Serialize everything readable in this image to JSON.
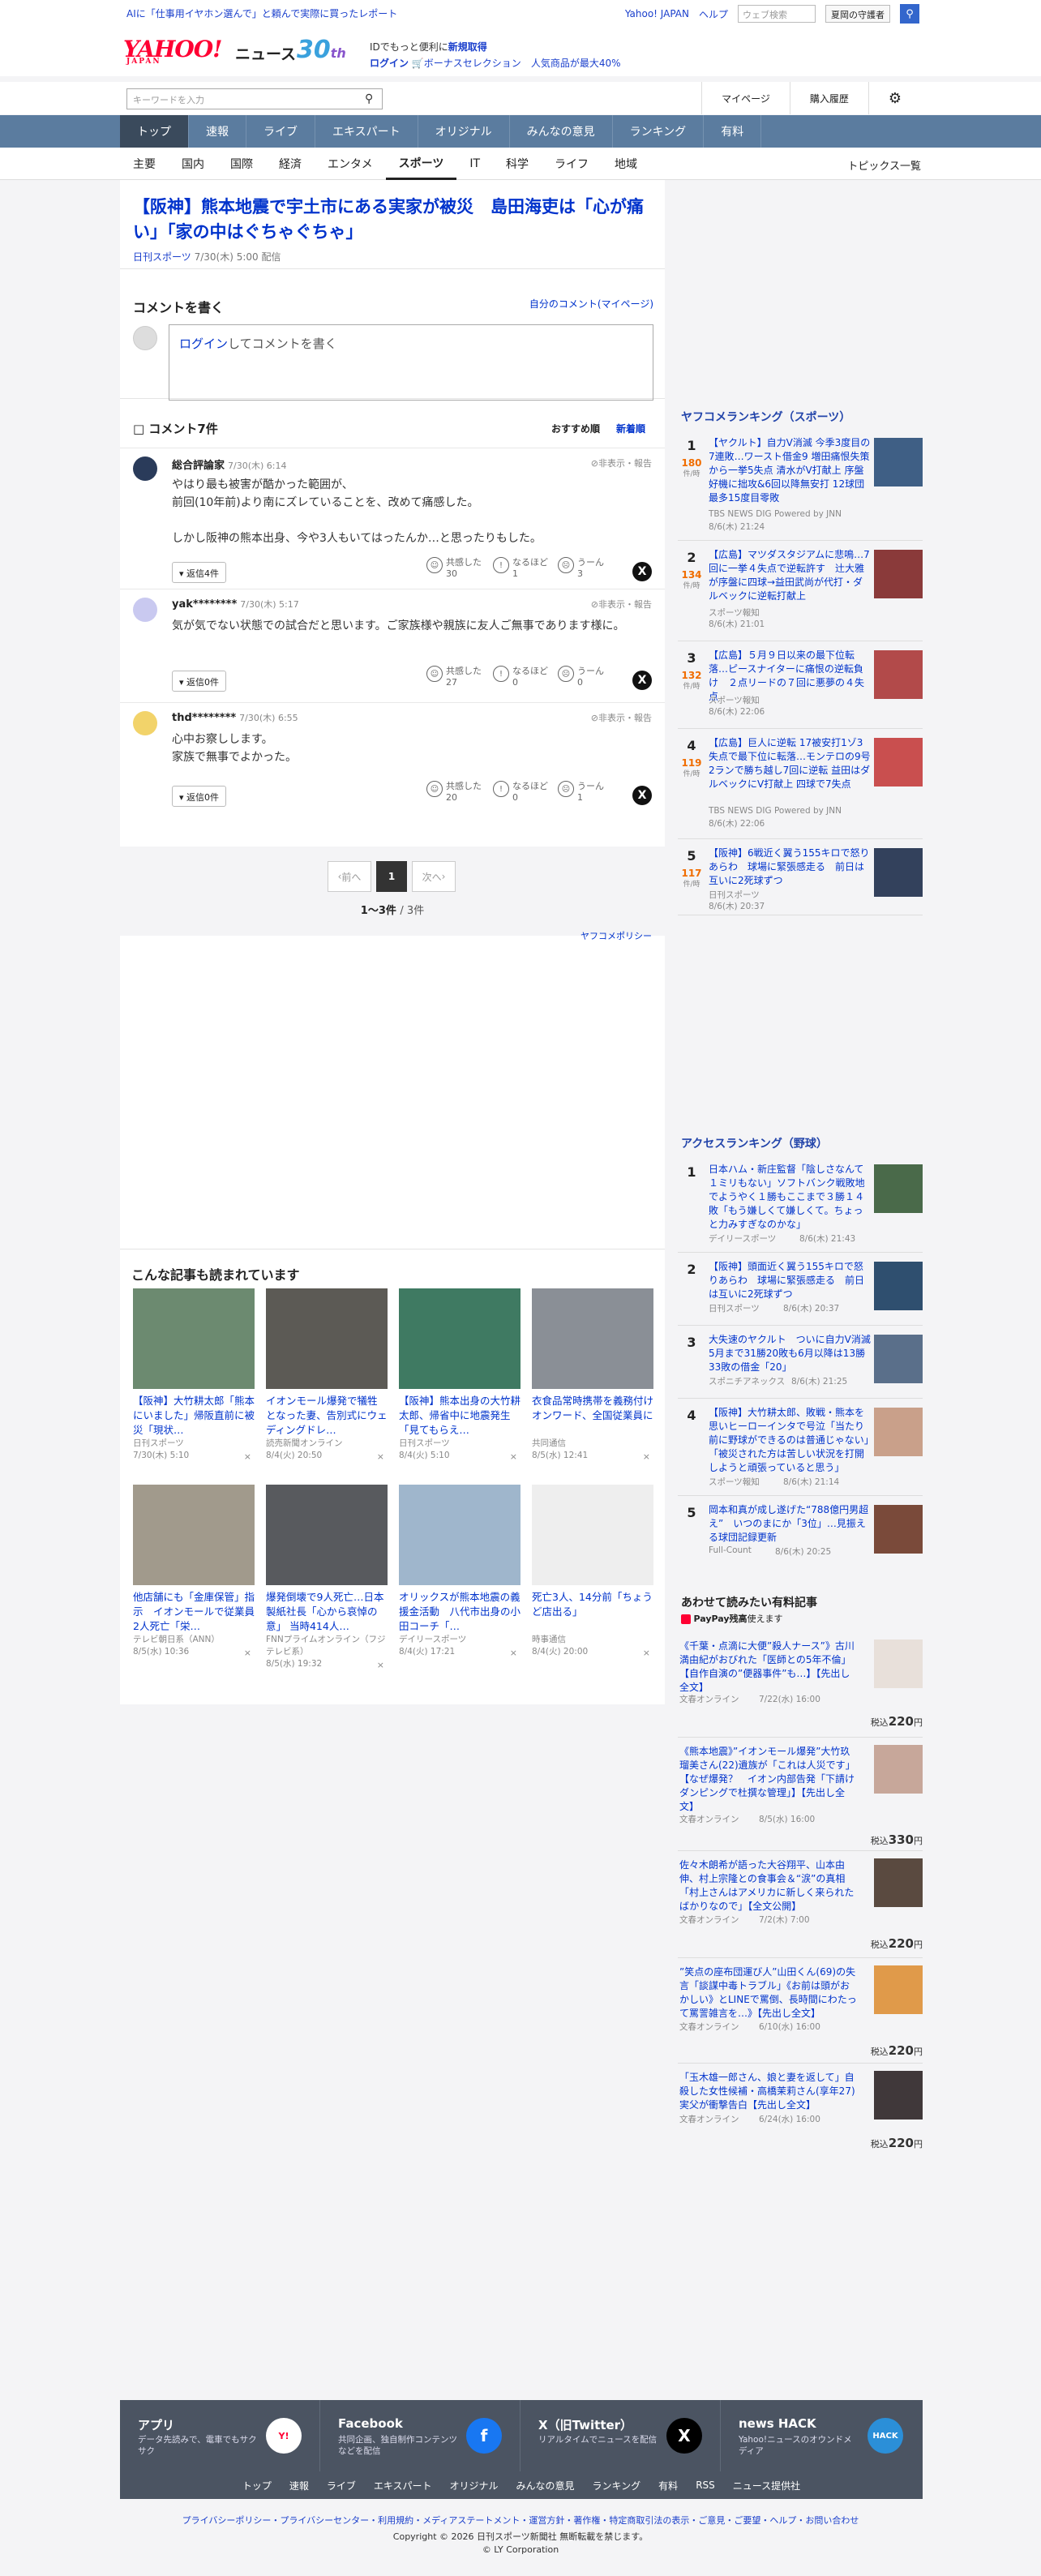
{
  "topbar": {
    "ad": "AIに「仕事用イヤホン選んで」と頼んで実際に買ったレポート",
    "links": [
      "Yahoo! JAPAN",
      "ヘルプ"
    ],
    "search_placeholder": "ウェブ検索",
    "search_btn": "夏岡の守護者"
  },
  "header": {
    "logo": "YAHOO!",
    "logo_sub": "JAPAN",
    "news": "ニュース",
    "anniv": "30",
    "anniv_suffix": "th",
    "line1a": "IDでもっと便利に",
    "line1b": "新規取得",
    "line2a": "ログイン",
    "line2b": "ボーナスセレクション",
    "line2c": "人気商品が最大40%"
  },
  "search": {
    "placeholder": "キーワードを入力",
    "mypage": "マイページ",
    "history": "購入履歴"
  },
  "nav": [
    "トップ",
    "速報",
    "ライブ",
    "エキスパート",
    "オリジナル",
    "みんなの意見",
    "ランキング",
    "有料"
  ],
  "subnav": [
    "主要",
    "国内",
    "国際",
    "経済",
    "エンタメ",
    "スポーツ",
    "IT",
    "科学",
    "ライフ",
    "地域"
  ],
  "topics_list": "トピックス一覧",
  "article": {
    "title": "【阪神】熊本地震で宇土市にある実家が被災　島田海吏は「心が痛い」「家の中はぐちゃぐちゃ」",
    "source": "日刊スポーツ",
    "date": "7/30(木) 5:00 配信"
  },
  "comment_write": {
    "title": "コメントを書く",
    "mine": "自分のコメント(マイページ)",
    "login": "ログイン",
    "prompt": "してコメントを書く"
  },
  "comments": {
    "count_label": "コメント7件",
    "sort": [
      "おすすめ順",
      "新着順"
    ],
    "items": [
      {
        "user": "総合評論家",
        "date": "7/30(木) 6:14",
        "hide": "非表示・報告",
        "body": "やはり最も被害が酷かった範囲が、\n前回(10年前)より南にズレていることを、改めて痛感した。\n\nしかし阪神の熊本出身、今や3人もいてはったんか…と思ったりもした。",
        "replies": "返信4件",
        "r1": "共感した",
        "c1": "30",
        "r2": "なるほど",
        "c2": "1",
        "r3": "うーん",
        "c3": "3"
      },
      {
        "user": "yak********",
        "date": "7/30(木) 5:17",
        "hide": "非表示・報告",
        "body": "気が気でない状態での試合だと思います。ご家族様や親族に友人ご無事であります様に。",
        "replies": "返信0件",
        "r1": "共感した",
        "c1": "27",
        "r2": "なるほど",
        "c2": "0",
        "r3": "うーん",
        "c3": "0"
      },
      {
        "user": "thd********",
        "date": "7/30(木) 6:55",
        "hide": "非表示・報告",
        "body": "心中お察しします。\n家族で無事でよかった。",
        "replies": "返信0件",
        "r1": "共感した",
        "c1": "20",
        "r2": "なるほど",
        "c2": "0",
        "r3": "うーん",
        "c3": "1"
      }
    ]
  },
  "pager": {
    "prev": "前へ",
    "page": "1",
    "next": "次へ",
    "count": "1〜3件",
    "total": "/ 3件",
    "policy": "ヤフコメポリシー"
  },
  "related": {
    "title": "こんな記事も読まれています",
    "cards": [
      {
        "t": "【阪神】大竹耕太郎「熊本にいました」帰阪直前に被災「現状…",
        "src": "日刊スポーツ",
        "date": "7/30(木) 5:10"
      },
      {
        "t": "イオンモール爆発で犠牲となった妻、告別式にウェディングドレ…",
        "src": "読売新聞オンライン",
        "date": "8/4(火) 20:50"
      },
      {
        "t": "【阪神】熊本出身の大竹耕太郎、帰省中に地震発生「見てもらえ…",
        "src": "日刊スポーツ",
        "date": "8/4(火) 5:10"
      },
      {
        "t": "衣食品常時携帯を義務付け　オンワード、全国従業員に",
        "src": "共同通信",
        "date": "8/5(水) 12:41"
      },
      {
        "t": "他店舗にも「金庫保管」指示　イオンモールで従業員2人死亡「栄…",
        "src": "テレビ朝日系（ANN）",
        "date": "8/5(水) 10:36"
      },
      {
        "t": "爆発倒壊で9人死亡…日本製紙社長「心から哀悼の意」 当時414人…",
        "src": "FNNプライムオンライン（フジテレビ系）",
        "date": "8/5(水) 19:32"
      },
      {
        "t": "オリックスが熊本地震の義援金活動　八代市出身の小田コーチ「…",
        "src": "デイリースポーツ",
        "date": "8/4(火) 17:21"
      },
      {
        "t": "死亡3人、14分前「ちょうど店出る」",
        "src": "時事通信",
        "date": "8/4(火) 20:00"
      }
    ]
  },
  "ranking1": {
    "title": "ヤフコメランキング（スポーツ）",
    "unit": "件/時",
    "items": [
      {
        "n": "1",
        "cnt": "180",
        "t": "【ヤクルト】自力V消滅 今季3度目の7連敗…ワースト借金9 増田痛恨失策から一挙5失点 清水がV打献上 序盤好機に拙攻&6回以降無安打 12球団最多15度目零敗",
        "src": "TBS NEWS DIG Powered by JNN",
        "date": "8/6(木) 21:24"
      },
      {
        "n": "2",
        "cnt": "134",
        "t": "【広島】マツダスタジアムに悲鳴…7回に一挙４失点で逆転許す　辻大雅が序盤に四球→益田武尚が代打・ダルベックに逆転打献上",
        "src": "スポーツ報知",
        "date": "8/6(木) 21:01"
      },
      {
        "n": "3",
        "cnt": "132",
        "t": "【広島】５月９日以来の最下位転落…ピースナイターに痛恨の逆転負け　２点リードの７回に悪夢の４失点",
        "src": "スポーツ報知",
        "date": "8/6(木) 22:06"
      },
      {
        "n": "4",
        "cnt": "119",
        "t": "【広島】巨人に逆転 17被安打1ゾ3失点で最下位に転落…モンテロの9号2ランで勝ち越し7回に逆転 益田はダルベックにV打献上 四球で7失点",
        "src": "TBS NEWS DIG Powered by JNN",
        "date": "8/6(木) 22:06"
      },
      {
        "n": "5",
        "cnt": "117",
        "t": "【阪神】6戦近く翼う155キロで怒りあらわ　球場に緊張感走る　前日は互いに2死球ずつ",
        "src": "日刊スポーツ",
        "date": "8/6(木) 20:37"
      }
    ]
  },
  "ranking2": {
    "title": "アクセスランキング（野球）",
    "items": [
      {
        "n": "1",
        "t": "日本ハム・新庄監督「陰しさなんて１ミリもない」ソフトバンク戦敗地でようやく１勝もここまで３勝１４敗「もう嫌しくて嫌しくて。ちょっと力みすぎなのかな」",
        "src": "デイリースポーツ",
        "date": "8/6(木) 21:43"
      },
      {
        "n": "2",
        "t": "【阪神】頭面近く翼う155キロで怒りあらわ　球場に緊張感走る　前日は互いに2死球ずつ",
        "src": "日刊スポーツ",
        "date": "8/6(木) 20:37"
      },
      {
        "n": "3",
        "t": "大失速のヤクルト　ついに自力V消滅　5月まで31勝20敗も6月以降は13勝33敗の借金「20」",
        "src": "スポニチアネックス",
        "date": "8/6(木) 21:25"
      },
      {
        "n": "4",
        "t": "【阪神】大竹耕太郎、敗戦・熊本を思いヒーローインタで号泣「当たり前に野球ができるのは普通じゃない」「被災された方は苦しい状況を打開しようと頑張っていると思う」",
        "src": "スポーツ報知",
        "date": "8/6(木) 21:14"
      },
      {
        "n": "5",
        "t": "岡本和真が成し遂げた“788億円男超え”　いつのまにか「3位」…見振える球団記録更新",
        "src": "Full-Count",
        "date": "8/6(木) 20:25"
      }
    ]
  },
  "paid": {
    "title": "あわせて読みたい有料記事",
    "paypay": "PayPay残高",
    "paypay_suffix": "使えます",
    "yen": "税込",
    "items": [
      {
        "t": "《千葉・点滴に大便”殺人ナース”》古川満由紀がおびれた「医師との5年不倫」【自作自演の”便器事件”も…】【先出し全文】",
        "src": "文春オンライン",
        "date": "7/22(水) 16:00",
        "price": "220",
        "unit": "円"
      },
      {
        "t": "《熊本地震》”イオンモール爆発”大竹玖瑠美さん(22)遺族が「これは人災です」【なぜ爆発？　イオン内部告発「下請けダンピングで杜撰な管理」】【先出し全文】",
        "src": "文春オンライン",
        "date": "8/5(水) 16:00",
        "price": "330",
        "unit": "円"
      },
      {
        "t": "佐々木朗希が語った大谷翔平、山本由伸、村上宗隆との食事会＆“涙”の真相「村上さんはアメリカに新しく来られたばかりなので」【全文公開】",
        "src": "文春オンライン",
        "date": "7/2(木) 7:00",
        "price": "220",
        "unit": "円"
      },
      {
        "t": "”笑点の座布団運び人”山田くん(69)の失言「談謀中毒トラブル」《お前は頭がおかしい》とLINEで罵倒、長時間にわたって罵詈雑言を…》【先出し全文】",
        "src": "文春オンライン",
        "date": "6/10(水) 16:00",
        "price": "220",
        "unit": "円"
      },
      {
        "t": "「玉木雄一郎さん、娘と妻を返して」自殺した女性候補・高橋茉莉さん(享年27)実父が衝撃告白【先出し全文】",
        "src": "文春オンライン",
        "date": "6/24(水) 16:00",
        "price": "220",
        "unit": "円"
      }
    ]
  },
  "footer": {
    "cols": [
      {
        "h": "アプリ",
        "d": "データ先読みで、電車でもサクサク"
      },
      {
        "h": "Facebook",
        "d": "共同企画、独自制作コンテンツなどを配信"
      },
      {
        "h": "X（旧Twitter）",
        "d": "リアルタイムでニュースを配信"
      },
      {
        "h": "news HACK",
        "d": "Yahoo!ニュースのオウンドメディア"
      }
    ],
    "nav": [
      "トップ",
      "速報",
      "ライブ",
      "エキスパート",
      "オリジナル",
      "みんなの意見",
      "ランキング",
      "有料",
      "RSS",
      "ニュース提供社"
    ],
    "legal": "プライバシーポリシー・プライバシーセンター・利用規約・メディアステートメント・運営方針・著作権・特定商取引法の表示・ご意見・ご要望・ヘルプ・お問い合わせ",
    "copy1": "Copyright © 2026 日刊スポーツ新聞社 無断転載を禁じます。",
    "copy2": "© LY Corporation"
  }
}
